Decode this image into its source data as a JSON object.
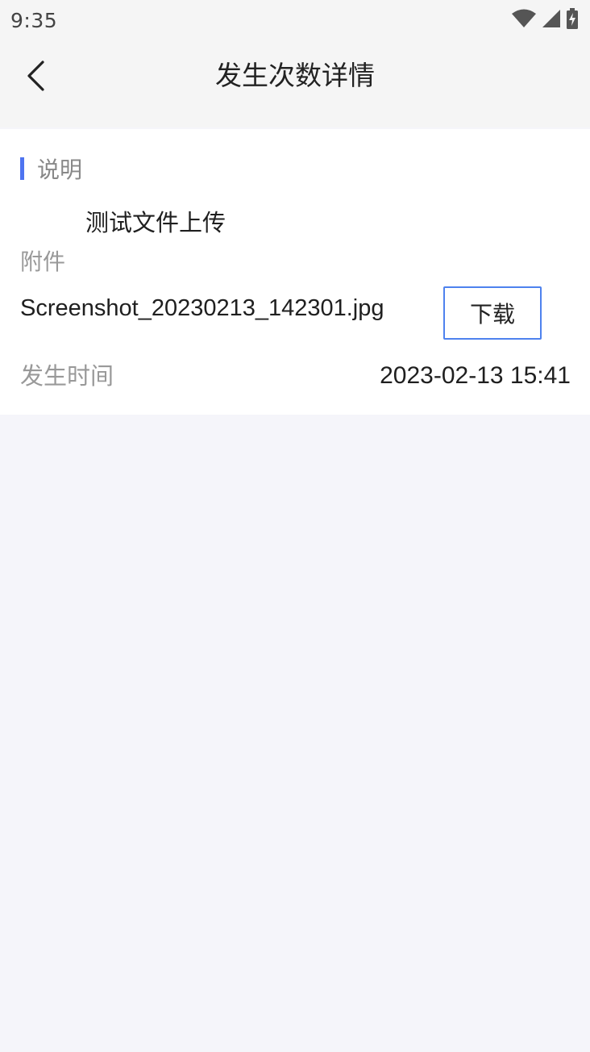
{
  "status_bar": {
    "time": "9:35",
    "icons": [
      "wifi-icon",
      "signal-icon",
      "battery-charging-icon"
    ]
  },
  "nav": {
    "back_icon": "chevron-left-icon",
    "title": "发生次数详情"
  },
  "detail": {
    "description_title": "说明",
    "description_value": "测试文件上传",
    "attachment_label": "附件",
    "attachment_filename": "Screenshot_20230213_142301.jpg",
    "download_label": "下载",
    "time_label": "发生时间",
    "time_value": "2023-02-13 15:41"
  },
  "colors": {
    "accent": "#4e74f0",
    "button_border": "#4e82ee",
    "background": "#f5f5fa",
    "card": "#ffffff"
  }
}
